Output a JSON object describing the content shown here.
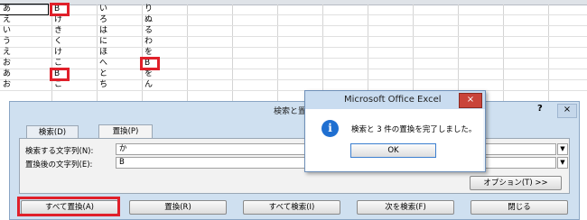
{
  "sheet": {
    "columns": {
      "a": [
        "あ",
        "え",
        "い",
        "う",
        "え",
        "お",
        "あ",
        "お"
      ],
      "b": [
        "B",
        "け",
        "き",
        "く",
        "け",
        "こ",
        "B",
        "こ"
      ],
      "c": [
        "い",
        "ろ",
        "は",
        "に",
        "ほ",
        "へ",
        "と",
        "ち"
      ],
      "d": [
        "り",
        "ぬ",
        "る",
        "わ",
        "を",
        "B",
        "を",
        "ん"
      ]
    }
  },
  "find_replace": {
    "title": "検索と置",
    "help": "?",
    "close": "×",
    "tabs": {
      "find": "検索(D)",
      "replace": "置換(P)"
    },
    "find_label": "検索する文字列(N):",
    "find_value": "か",
    "replace_label": "置換後の文字列(E):",
    "replace_value": "B",
    "options_button": "オプション(T) >>",
    "buttons": {
      "replace_all": "すべて置換(A)",
      "replace": "置換(R)",
      "find_all": "すべて検索(I)",
      "find_next": "次を検索(F)",
      "close": "閉じる"
    }
  },
  "message_box": {
    "title": "Microsoft Office Excel",
    "close": "×",
    "icon": "info-icon",
    "text": "検索と 3 件の置換を完了しました。",
    "ok": "OK"
  }
}
